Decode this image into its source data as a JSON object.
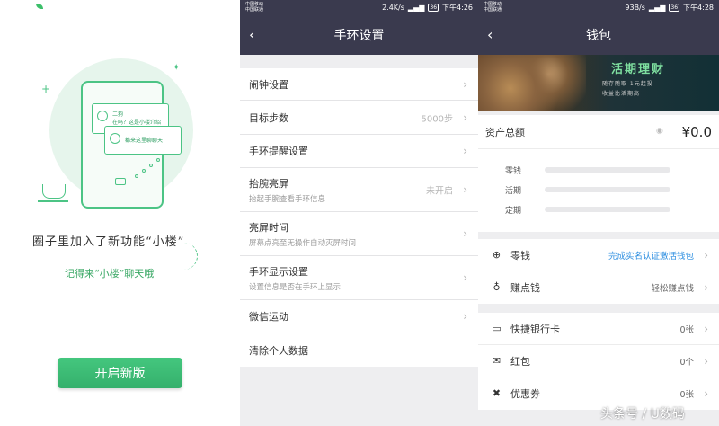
{
  "intro": {
    "headline": "圈子里加入了新功能“小楼”",
    "subline": "记得来“小楼”聊天哦",
    "card_name": "二狗",
    "card_msg": "在吗？这是小楼介绍",
    "card2_msg": "都来这里聊聊天",
    "start_button": "开启新版"
  },
  "band": {
    "status": {
      "carrier1": "中国移动",
      "carrier2": "中国联通",
      "speed": "2.4K/s",
      "battery": "36",
      "time": "下午4:26"
    },
    "nav_title": "手环设置",
    "items": [
      {
        "label": "闹钟设置",
        "sub": "",
        "value": ""
      },
      {
        "label": "目标步数",
        "sub": "",
        "value": "5000步"
      },
      {
        "label": "手环提醒设置",
        "sub": "",
        "value": ""
      },
      {
        "label": "抬腕亮屏",
        "sub": "抬起手腕查看手环信息",
        "value": "未开启"
      },
      {
        "label": "亮屏时间",
        "sub": "屏幕点亮至无操作自动灭屏时间",
        "value": ""
      },
      {
        "label": "手环显示设置",
        "sub": "设置信息是否在手环上显示",
        "value": ""
      },
      {
        "label": "微信运动",
        "sub": "",
        "value": ""
      },
      {
        "label": "清除个人数据",
        "sub": "",
        "value": ""
      }
    ]
  },
  "wallet": {
    "status": {
      "carrier1": "中国移动",
      "carrier2": "中国联通",
      "speed": "93B/s",
      "battery": "36",
      "time": "下午4:28"
    },
    "nav_title": "钱包",
    "banner": {
      "title": "活期理财",
      "line1": "随存随取  1元起投",
      "line2": "收益比活期高"
    },
    "assets_label": "资产总额",
    "assets_amount": "¥0.0",
    "asset_rows": [
      "零钱",
      "活期",
      "定期"
    ],
    "group1": [
      {
        "icon": "plus-circle-icon",
        "glyph": "⊕",
        "label": "零钱",
        "value": "完成实名认证激活钱包"
      },
      {
        "icon": "money-bag-icon",
        "glyph": "♁",
        "label": "赚点钱",
        "value": "轻松赚点钱"
      }
    ],
    "group2": [
      {
        "icon": "card-icon",
        "glyph": "▭",
        "label": "快捷银行卡",
        "value": "0张"
      },
      {
        "icon": "red-packet-icon",
        "glyph": "✉",
        "label": "红包",
        "value": "0个"
      },
      {
        "icon": "coupon-icon",
        "glyph": "✖",
        "label": "优惠券",
        "value": "0张"
      }
    ],
    "link_color": "#2a8de0"
  },
  "watermark": "头条号 / U数码",
  "colors": {
    "brand_green": "#3cbf6a",
    "nav_bg": "#3a3a4e"
  }
}
